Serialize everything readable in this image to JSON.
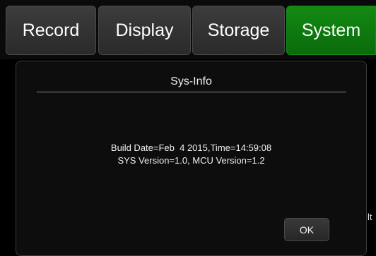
{
  "tabs": [
    {
      "label": "Record",
      "active": false
    },
    {
      "label": "Display",
      "active": false
    },
    {
      "label": "Storage",
      "active": false
    },
    {
      "label": "System",
      "active": true
    }
  ],
  "dialog": {
    "title": "Sys-Info",
    "lines": [
      "Build Date=Feb  4 2015,Time=14:59:08",
      "SYS Version=1.0, MCU Version=1.2"
    ],
    "ok_label": "OK"
  },
  "edge_text": "lt",
  "colors": {
    "active_tab": "#0b6b0b",
    "tab": "#333333",
    "background": "#000000",
    "text": "#f0f0f0"
  }
}
